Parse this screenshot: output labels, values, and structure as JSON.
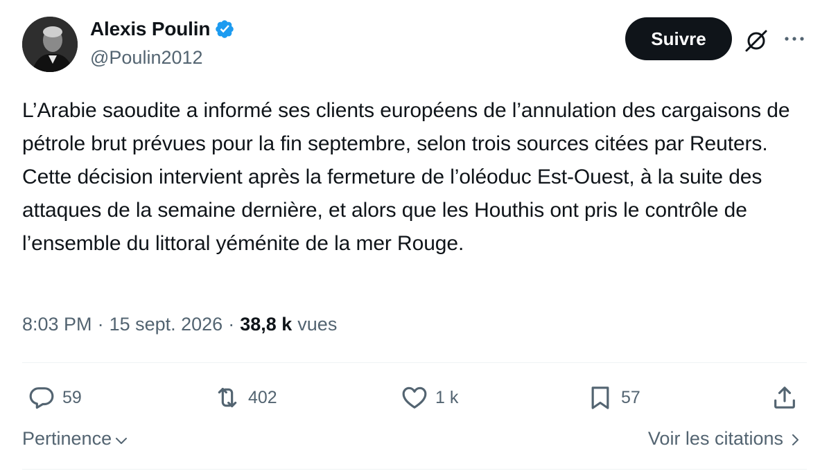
{
  "author": {
    "name": "Alexis Poulin",
    "handle": "@Poulin2012"
  },
  "follow_label": "Suivre",
  "tweet": {
    "text": "L’Arabie saoudite a informé ses clients européens de l’annulation des cargaisons de pétrole brut prévues pour la fin septembre, selon trois sources citées par Reuters. Cette décision intervient après la fermeture de l’oléoduc Est-Ouest, à la suite des attaques de la semaine dernière, et alors que les Houthis ont pris le contrôle de l’ensemble du littoral yéménite de la mer Rouge."
  },
  "meta": {
    "time": "8:03 PM",
    "separator": "·",
    "date": "15 sept. 2026",
    "views_count": "38,8 k",
    "views_label": "vues"
  },
  "actions": {
    "replies": "59",
    "reposts": "402",
    "likes": "1 k",
    "bookmarks": "57"
  },
  "footer": {
    "sort_label": "Pertinence",
    "quotes_label": "Voir les citations"
  },
  "icons": {
    "verified": "verified-badge-icon",
    "grok": "grok-icon",
    "more": "more-dots-icon",
    "reply": "reply-icon",
    "repost": "repost-icon",
    "like": "heart-icon",
    "bookmark": "bookmark-icon",
    "share": "share-icon"
  },
  "colors": {
    "primary_text": "#0f1419",
    "secondary_text": "#536471",
    "verified_blue": "#1d9bf0",
    "divider": "#eff3f4",
    "button_bg": "#0f1419"
  }
}
